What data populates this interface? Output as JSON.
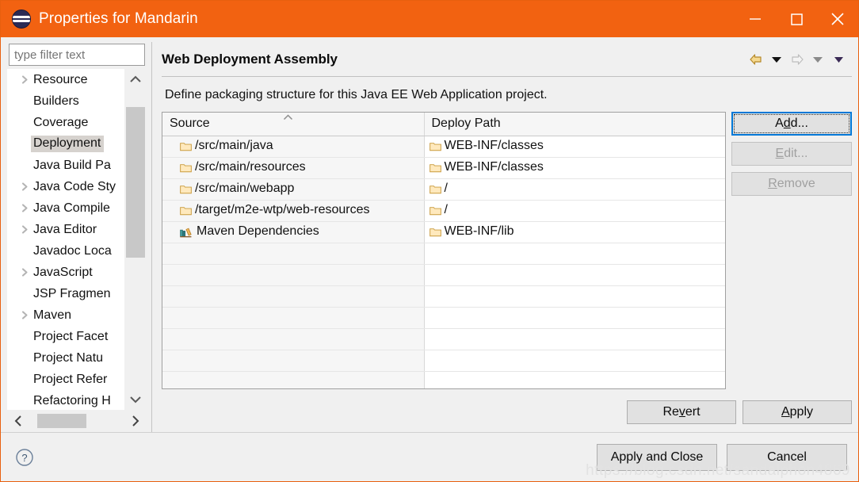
{
  "window": {
    "title": "Properties for Mandarin",
    "logo_icon": "eclipse-logo",
    "minimize_icon": "minimize-icon",
    "maximize_icon": "maximize-icon",
    "close_icon": "close-icon",
    "accent_color": "#f26211"
  },
  "sidebar": {
    "filter_placeholder": "type filter text",
    "filter_value": "",
    "selected": "Deployment",
    "items": [
      {
        "label": "Resource",
        "expandable": true
      },
      {
        "label": "Builders",
        "expandable": false
      },
      {
        "label": "Coverage",
        "expandable": false
      },
      {
        "label": "Deployment",
        "expandable": false
      },
      {
        "label": "Java Build Pa",
        "expandable": false
      },
      {
        "label": "Java Code Sty",
        "expandable": true
      },
      {
        "label": "Java Compile",
        "expandable": true
      },
      {
        "label": "Java Editor",
        "expandable": true
      },
      {
        "label": "Javadoc Loca",
        "expandable": false
      },
      {
        "label": "JavaScript",
        "expandable": true
      },
      {
        "label": "JSP Fragmen",
        "expandable": false
      },
      {
        "label": "Maven",
        "expandable": true
      },
      {
        "label": "Project Facet",
        "expandable": false
      },
      {
        "label": "Project Natu",
        "expandable": false
      },
      {
        "label": "Project Refer",
        "expandable": false
      },
      {
        "label": "Refactoring H",
        "expandable": false
      }
    ],
    "scroll_up_icon": "chevron-up-icon",
    "scroll_down_icon": "chevron-down-icon",
    "scroll_left_icon": "chevron-left-icon",
    "scroll_right_icon": "chevron-right-icon"
  },
  "page": {
    "title": "Web Deployment Assembly",
    "description": "Define packaging structure for this Java EE Web Application project.",
    "nav": {
      "back_icon": "back-arrow-icon",
      "back_menu_icon": "caret-down-icon",
      "forward_icon": "forward-arrow-icon",
      "forward_menu_icon": "caret-down-icon",
      "view_menu_icon": "caret-down-icon"
    }
  },
  "table": {
    "columns": [
      "Source",
      "Deploy Path"
    ],
    "sort_column": "Source",
    "sort_indicator": "ascending",
    "rows": [
      {
        "source": "/src/main/java",
        "source_icon": "folder-icon",
        "deploy": "WEB-INF/classes",
        "deploy_icon": "folder-icon"
      },
      {
        "source": "/src/main/resources",
        "source_icon": "folder-icon",
        "deploy": "WEB-INF/classes",
        "deploy_icon": "folder-icon"
      },
      {
        "source": "/src/main/webapp",
        "source_icon": "folder-icon",
        "deploy": "/",
        "deploy_icon": "folder-icon"
      },
      {
        "source": "/target/m2e-wtp/web-resources",
        "source_icon": "folder-icon",
        "deploy": "/",
        "deploy_icon": "folder-icon"
      },
      {
        "source": "Maven Dependencies",
        "source_icon": "library-books-icon",
        "deploy": "WEB-INF/lib",
        "deploy_icon": "folder-icon"
      }
    ],
    "empty_row_count": 7
  },
  "side_buttons": [
    {
      "label": "Add...",
      "mnemonic": "d",
      "state": "focused"
    },
    {
      "label": "Edit...",
      "mnemonic": "E",
      "state": "disabled"
    },
    {
      "label": "Remove",
      "mnemonic": "R",
      "state": "disabled"
    }
  ],
  "apply_row": {
    "revert_label": "Revert",
    "revert_mnemonic": "v",
    "apply_label": "Apply",
    "apply_mnemonic": "A"
  },
  "footer": {
    "help_icon": "help-circle-icon",
    "apply_and_close_label": "Apply and Close",
    "cancel_label": "Cancel",
    "watermark": "https://blog.csdn.net/sandalphon4869"
  }
}
